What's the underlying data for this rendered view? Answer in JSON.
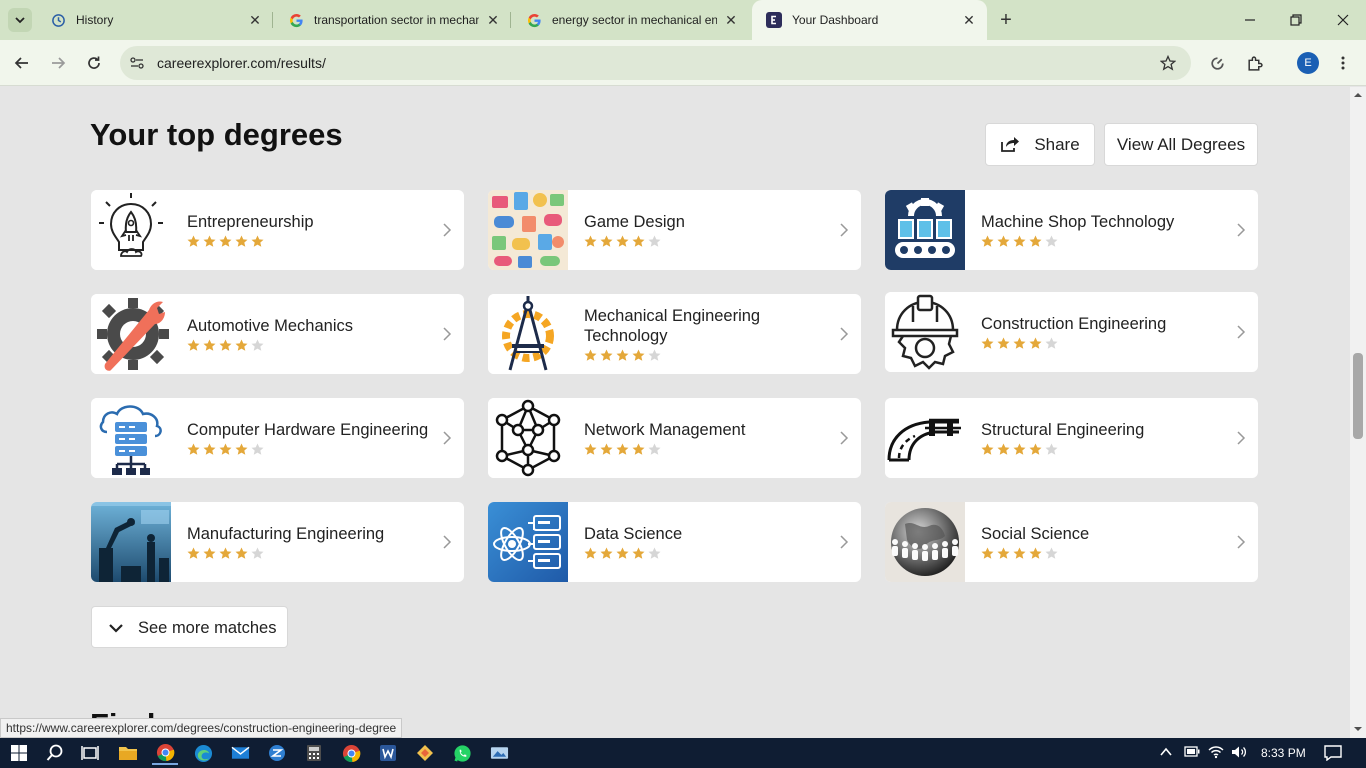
{
  "browser": {
    "tabs": [
      {
        "title": "History",
        "favicon": "history-icon",
        "active": false
      },
      {
        "title": "transportation sector in mechan",
        "favicon": "google-icon",
        "active": false
      },
      {
        "title": "energy sector in mechanical eng",
        "favicon": "google-icon",
        "active": false
      },
      {
        "title": "Your Dashboard",
        "favicon": "careerexplorer-icon",
        "active": true
      }
    ],
    "url": "careerexplorer.com/results/",
    "profile_initial": "E"
  },
  "page": {
    "title": "Your top degrees",
    "share_label": "Share",
    "view_all_label": "View All Degrees",
    "see_more_label": "See more matches",
    "next_heading": "Find your new career"
  },
  "degrees": [
    {
      "name": "Entrepreneurship",
      "rating": 5,
      "icon": "rocket-bulb-icon"
    },
    {
      "name": "Game Design",
      "rating": 4,
      "icon": "game-collage-image"
    },
    {
      "name": "Machine Shop Technology",
      "rating": 4,
      "icon": "conveyor-gear-icon"
    },
    {
      "name": "Automotive Mechanics",
      "rating": 4,
      "icon": "gear-wrench-icon"
    },
    {
      "name": "Mechanical Engineering Technology",
      "rating": 4,
      "icon": "compass-gear-icon"
    },
    {
      "name": "Construction Engineering",
      "rating": 4,
      "icon": "hardhat-gear-icon"
    },
    {
      "name": "Computer Hardware Engineering",
      "rating": 4,
      "icon": "cloud-server-icon"
    },
    {
      "name": "Network Management",
      "rating": 4,
      "icon": "network-nodes-icon"
    },
    {
      "name": "Structural Engineering",
      "rating": 4,
      "icon": "road-bridge-icon"
    },
    {
      "name": "Manufacturing Engineering",
      "rating": 4,
      "icon": "factory-robot-image"
    },
    {
      "name": "Data Science",
      "rating": 4,
      "icon": "atom-database-icon"
    },
    {
      "name": "Social Science",
      "rating": 4,
      "icon": "globe-people-image"
    }
  ],
  "status_url": "https://www.careerexplorer.com/degrees/construction-engineering-degree",
  "taskbar": {
    "time": "8:33 PM"
  },
  "colors": {
    "star_filled": "#e4a83a",
    "star_empty": "#d6d6d6",
    "tabstrip": "#d3e3c7",
    "toolbar": "#f1f6ec"
  }
}
